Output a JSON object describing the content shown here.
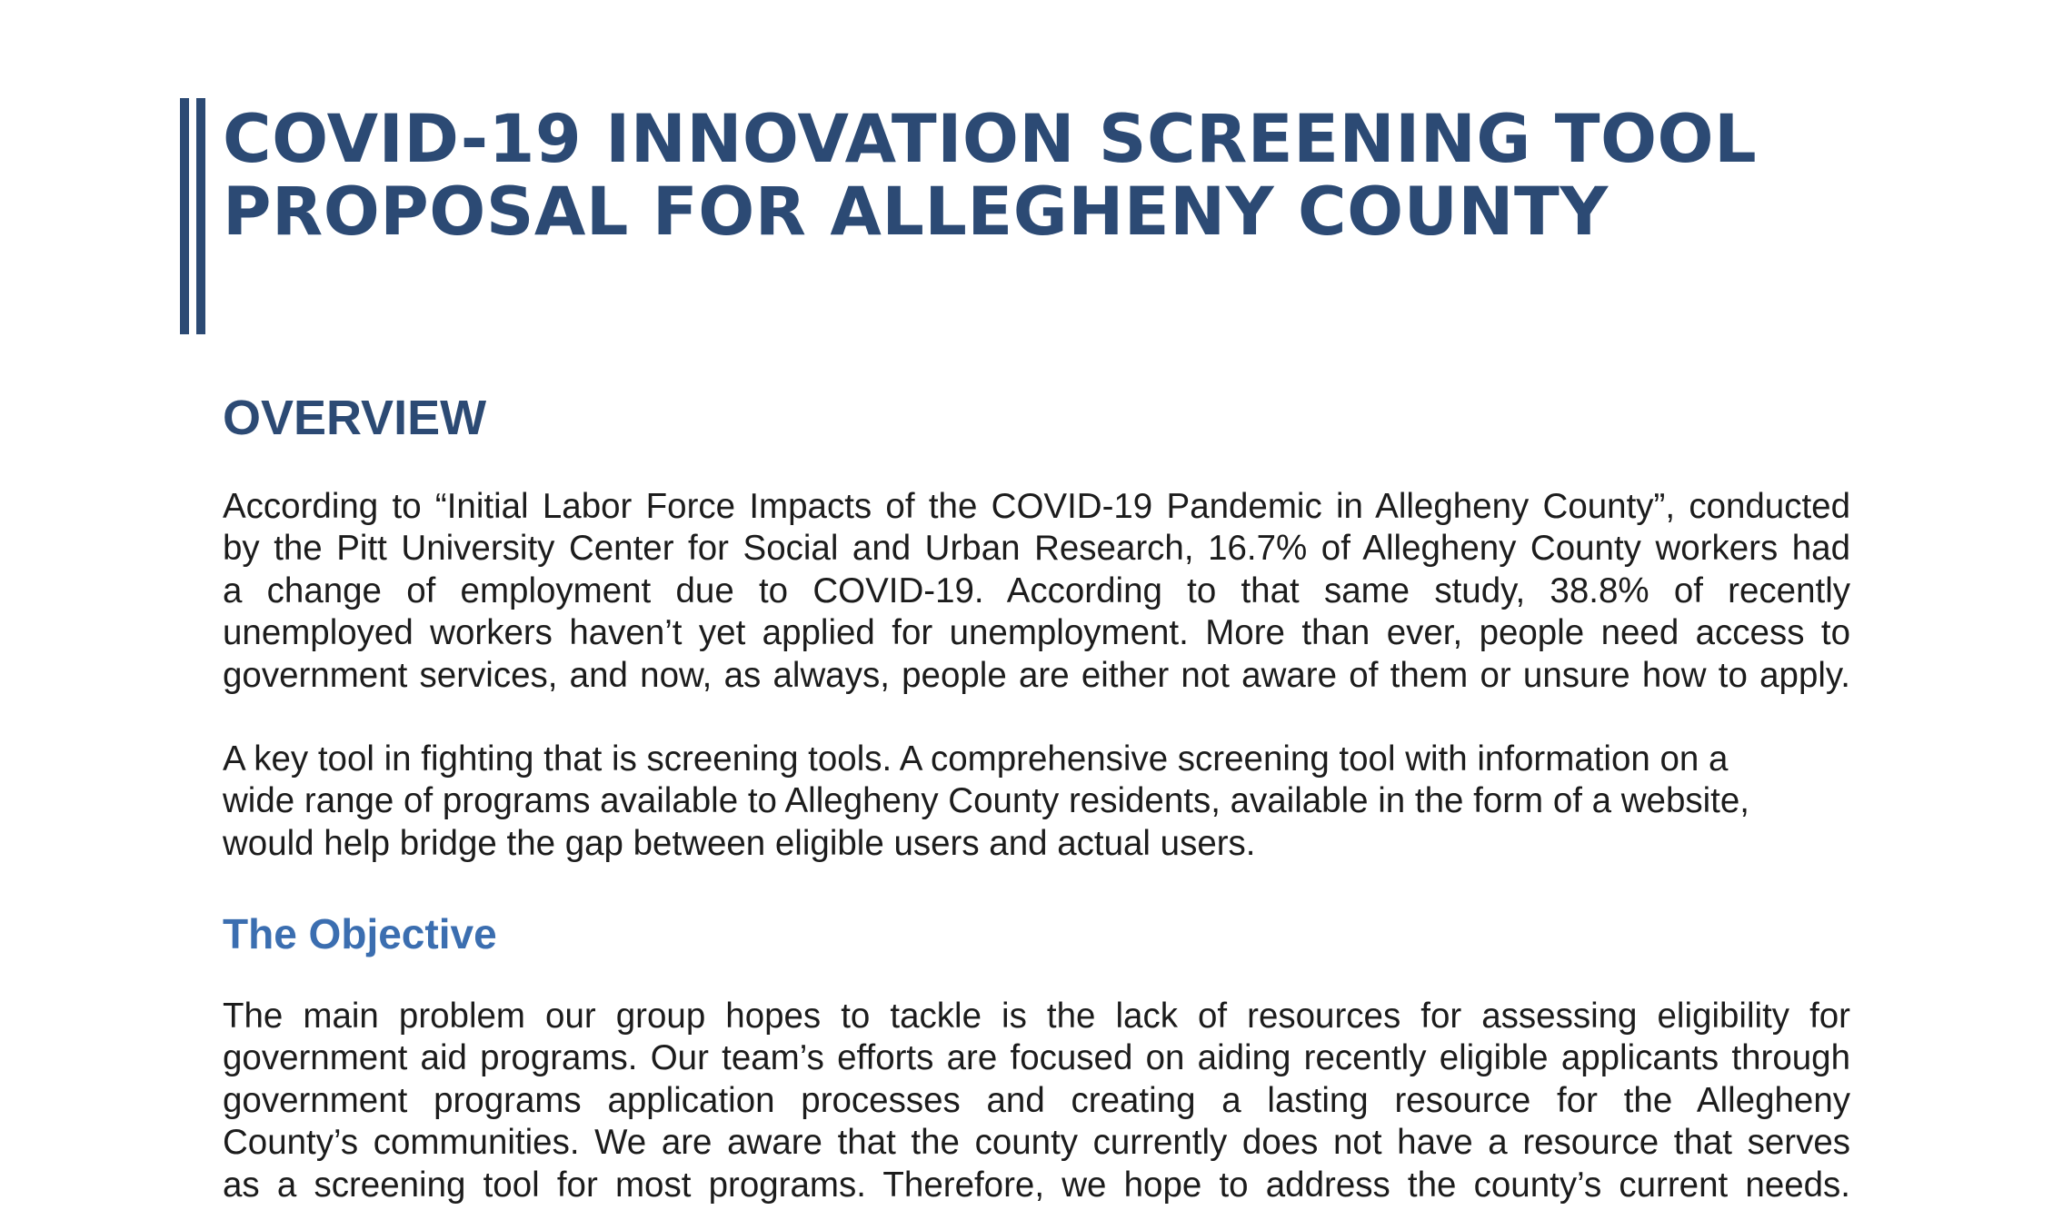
{
  "document": {
    "title_lines": [
      "COVID-19 INNOVATION SCREENING TOOL",
      "PROPOSAL FOR ALLEGHENY COUNTY"
    ],
    "overview": {
      "heading": "OVERVIEW",
      "paragraph1_lines": [
        "According to “Initial Labor Force Impacts of the COVID-19 Pandemic in Allegheny County”, conducted",
        "by the Pitt University Center for Social and Urban Research, 16.7% of Allegheny County workers had",
        "a change of employment due to COVID-19. According to that same study, 38.8% of recently",
        "unemployed workers haven’t yet applied for unemployment. More than ever, people need access to",
        "government services, and now, as always, people are either not aware of them or unsure how to apply."
      ],
      "paragraph2_lines": [
        "A key tool in fighting that is screening tools. A comprehensive screening tool with information on a",
        "wide range of programs available to Allegheny County residents, available in the form of a website,",
        "would help bridge the gap between eligible users and actual users."
      ]
    },
    "objective": {
      "heading": "The Objective",
      "paragraph_lines": [
        "The main problem our group hopes to tackle is the lack of resources for assessing eligibility for",
        "government aid programs. Our team’s efforts are focused on aiding recently eligible applicants through",
        "government programs application processes and creating a lasting resource for the Allegheny",
        "County’s communities. We are aware that the county currently does not have a resource that serves",
        "as a screening tool for most programs. Therefore, we hope to address the county’s current needs."
      ]
    }
  },
  "colors": {
    "title": "#2c4a74",
    "heading": "#2c4a74",
    "subheading": "#3b6eb0",
    "body_text": "#1c1c1c",
    "background": "#ffffff"
  }
}
